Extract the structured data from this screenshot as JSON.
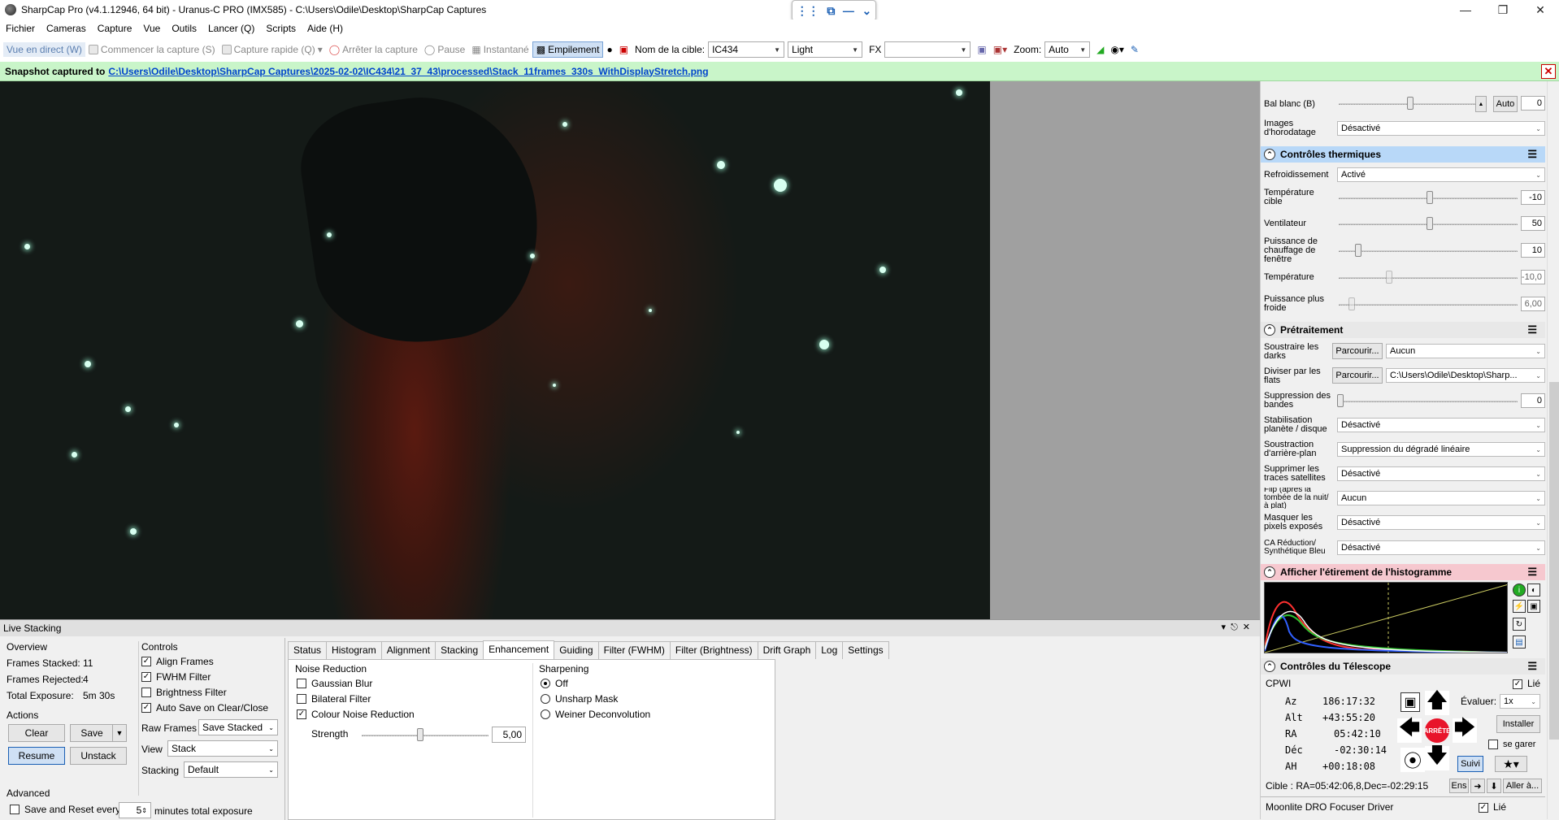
{
  "titlebar": {
    "title": "SharpCap Pro (v4.1.12946, 64 bit) - Uranus-C PRO (IMX585) - C:\\Users\\Odile\\Desktop\\SharpCap Captures"
  },
  "menu": [
    "Fichier",
    "Cameras",
    "Capture",
    "Vue",
    "Outils",
    "Lancer (Q)",
    "Scripts",
    "Aide (H)"
  ],
  "toolbar": {
    "live_view": "Vue en direct (W)",
    "start_capture": "Commencer la capture (S)",
    "quick_capture": "Capture rapide (Q)",
    "stop_capture": "Arrêter la capture",
    "pause": "Pause",
    "snapshot": "Instantané",
    "stacking": "Empilement",
    "target_label": "Nom de la cible:",
    "target_value": "IC434",
    "frame_type": "Light",
    "fx_label": "FX",
    "fx_value": "",
    "zoom_label": "Zoom:",
    "zoom_value": "Auto"
  },
  "snapshot_bar": {
    "prefix": "Snapshot captured to",
    "path": "C:\\Users\\Odile\\Desktop\\SharpCap Captures\\2025-02-02\\IC434\\21_37_43\\processed\\Stack_11frames_330s_WithDisplayStretch.png"
  },
  "right_panel": {
    "white_balance_b": {
      "label": "Bal blanc (B)",
      "auto": "Auto",
      "value": "0"
    },
    "timestamp": {
      "label": "Images d'horodatage",
      "value": "Désactivé"
    },
    "thermal": {
      "title": "Contrôles thermiques",
      "cooling": {
        "label": "Refroidissement",
        "value": "Activé"
      },
      "target_temp": {
        "label": "Température cible",
        "value": "-10"
      },
      "fan": {
        "label": "Ventilateur",
        "value": "50"
      },
      "heater": {
        "label": "Puissance de chauffage de fenêtre",
        "value": "10"
      },
      "temperature": {
        "label": "Température",
        "value": "-10,0"
      },
      "cooler_power": {
        "label": "Puissance plus froide",
        "value": "6,00"
      }
    },
    "preprocessing": {
      "title": "Prétraitement",
      "darks": {
        "label": "Soustraire les darks",
        "browse": "Parcourir...",
        "value": "Aucun"
      },
      "flats": {
        "label": "Diviser par les flats",
        "browse": "Parcourir...",
        "value": "C:\\Users\\Odile\\Desktop\\Sharp..."
      },
      "banding": {
        "label": "Suppression des bandes",
        "value": "0"
      },
      "stabilization": {
        "label": "Stabilisation planète / disque",
        "value": "Désactivé"
      },
      "background": {
        "label": "Soustraction d'arrière-plan",
        "value": "Suppression du dégradé linéaire"
      },
      "satellite": {
        "label": "Supprimer les traces satellites",
        "value": "Désactivé"
      },
      "flip": {
        "label": "Flip (après la tombée de la nuit/à plat)",
        "value": "Aucun"
      },
      "mask": {
        "label": "Masquer les pixels exposés",
        "value": "Désactivé"
      },
      "ca": {
        "label": "CA Réduction/ Synthétique Bleu",
        "value": "Désactivé"
      }
    },
    "histogram": {
      "title": "Afficher l'étirement de l'histogramme"
    },
    "telescope": {
      "title": "Contrôles du Télescope",
      "mount": "CPWI",
      "linked": "Lié",
      "az": {
        "label": "Az",
        "value": "186:17:32"
      },
      "alt": {
        "label": "Alt",
        "value": "+43:55:20"
      },
      "ra": {
        "label": "RA",
        "value": "05:42:10"
      },
      "dec": {
        "label": "Déc",
        "value": "-02:30:14"
      },
      "ah": {
        "label": "AH",
        "value": "+00:18:08"
      },
      "rate_label": "Évaluer:",
      "rate_value": "1x",
      "install": "Installer",
      "park": "se garer",
      "stop": "ARRÊTE",
      "track": "Suivi",
      "target": "Cible : RA=05:42:06,8,Dec=-02:29:15",
      "ens": "Ens",
      "goto": "Aller à..."
    },
    "focuser": {
      "name": "Moonlite DRO Focuser Driver",
      "linked": "Lié"
    }
  },
  "live_stacking": {
    "title": "Live Stacking",
    "overview": {
      "title": "Overview",
      "frames_stacked_label": "Frames Stacked:",
      "frames_stacked": "11",
      "frames_rejected_label": "Frames Rejected:",
      "frames_rejected": "4",
      "total_exposure_label": "Total Exposure:",
      "total_exposure": "5m 30s"
    },
    "actions": {
      "title": "Actions",
      "clear": "Clear",
      "save": "Save",
      "resume": "Resume",
      "unstack": "Unstack"
    },
    "advanced": {
      "title": "Advanced",
      "save_reset": "Save and Reset every",
      "minutes_value": "5",
      "minutes_label": "minutes total exposure"
    },
    "controls": {
      "title": "Controls",
      "align": "Align Frames",
      "fwhm": "FWHM Filter",
      "brightness": "Brightness Filter",
      "autosave": "Auto Save on Clear/Close",
      "raw_frames_label": "Raw Frames",
      "raw_frames_value": "Save Stacked",
      "view_label": "View",
      "view_value": "Stack",
      "stacking_label": "Stacking",
      "stacking_value": "Default"
    },
    "tabs": [
      "Status",
      "Histogram",
      "Alignment",
      "Stacking",
      "Enhancement",
      "Guiding",
      "Filter (FWHM)",
      "Filter (Brightness)",
      "Drift Graph",
      "Log",
      "Settings"
    ],
    "enhancement": {
      "noise_title": "Noise Reduction",
      "gaussian": "Gaussian Blur",
      "bilateral": "Bilateral Filter",
      "colour_noise": "Colour Noise Reduction",
      "strength_label": "Strength",
      "strength_value": "5,00",
      "sharpening_title": "Sharpening",
      "off": "Off",
      "unsharp": "Unsharp Mask",
      "weiner": "Weiner Deconvolution"
    }
  }
}
